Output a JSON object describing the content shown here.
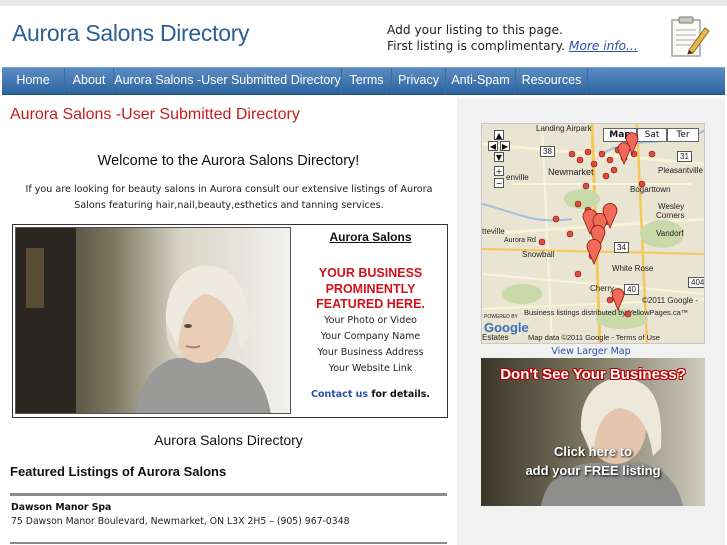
{
  "header": {
    "title": "Aurora Salons Directory",
    "promo_line1": "Add your listing to this page.",
    "promo_line2": "First listing is complimentary.",
    "promo_link": "More info..."
  },
  "nav": {
    "items": [
      {
        "label": "Home"
      },
      {
        "label": "About"
      },
      {
        "label": "Aurora Salons -User Submitted Directory"
      },
      {
        "label": "Terms"
      },
      {
        "label": "Privacy"
      },
      {
        "label": "Anti-Spam"
      },
      {
        "label": "Resources"
      }
    ]
  },
  "main": {
    "page_title": "Aurora Salons -User Submitted Directory",
    "welcome": "Welcome to the Aurora Salons Directory!",
    "intro": "If you are looking for beauty salons in Aurora consult our extensive listings of Aurora Salons featuring hair,nail,beauty,esthetics and tanning services.",
    "feature": {
      "title": "Aurora Salons",
      "headline_line1": "YOUR BUSINESS",
      "headline_line2": "PROMINENTLY",
      "headline_line3": "FEATURED HERE.",
      "lines": [
        "Your Photo or Video",
        "Your Company Name",
        "Your Business Address",
        "Your Website Link"
      ],
      "contact_link": "Contact us",
      "contact_suffix": " for details."
    },
    "directory_heading": "Aurora Salons Directory",
    "featured_heading": "Featured Listings of Aurora Salons",
    "listings": [
      {
        "name": "Dawson Manor Spa",
        "address": "75 Dawson Manor Boulevard, Newmarket, ON L3X 2H5 – (905) 967-0348"
      }
    ]
  },
  "sidebar": {
    "map": {
      "buttons": [
        "Map",
        "Sat",
        "Ter"
      ],
      "labels": {
        "landing": "Landing Airpark",
        "newmarket": "Newmarket",
        "pleasantville": "Pleasantville",
        "bogarttown": "Bogarttown",
        "wesley": "Wesley",
        "corners": "Corners",
        "vandorf": "Vandorf",
        "snowball": "Snowball",
        "whiterose": "White Rose",
        "cherry": "Cherry",
        "henville": "enville",
        "tteville": "tteville",
        "rd": "Aurora Rd",
        "r38": "38",
        "r34": "34",
        "r40": "40",
        "r404": "404",
        "r31": "31",
        "copyright": "©2011 Google -",
        "listings": "Business listings distributed by YellowPages.ca™",
        "mapdata": "Map data ©2011 Google - Terms of Use",
        "estates": "Estates",
        "powered": "POWERED BY",
        "google": "Google"
      }
    },
    "view_larger_map": "View Larger Map",
    "banner": {
      "headline": "Don't See Your Business?",
      "cta_line1": "Click here to",
      "cta_line2": "add your FREE listing"
    }
  },
  "colors": {
    "nav_bg": "#2c64a0",
    "title_blue": "#2b5f96",
    "accent_red": "#c81c1c",
    "link_blue": "#2a52a8"
  }
}
